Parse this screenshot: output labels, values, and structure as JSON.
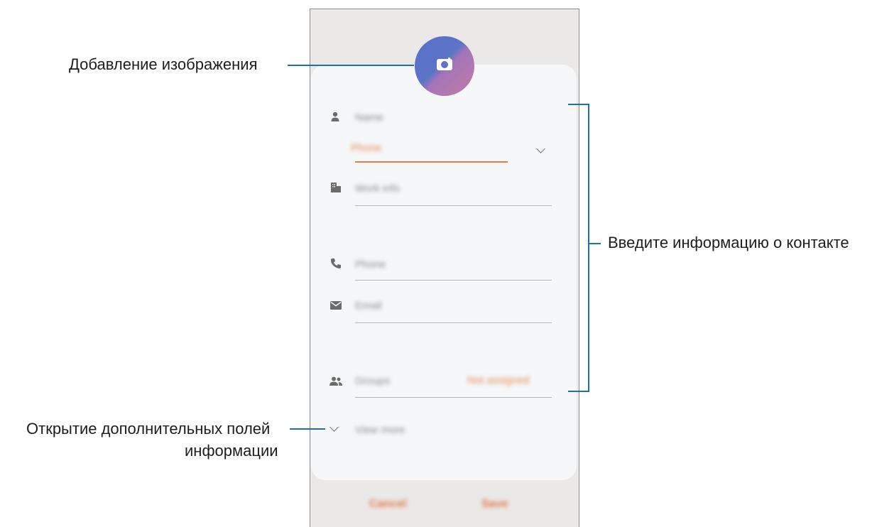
{
  "callouts": {
    "add_image": "Добавление изображения",
    "enter_info": "Введите информацию о контакте",
    "more_fields_line1": "Открытие дополнительных полей",
    "more_fields_line2": "информации"
  },
  "form": {
    "name_placeholder": "Name",
    "storage_label": "Phone",
    "organisation_placeholder": "Work info",
    "phone_placeholder": "Phone",
    "email_placeholder": "Email",
    "groups_label": "Groups",
    "groups_value": "Not assigned",
    "view_more_label": "View more"
  },
  "buttons": {
    "cancel": "Cancel",
    "save": "Save"
  },
  "icons": {
    "avatar": "camera-icon",
    "name": "person-icon",
    "organisation": "building-icon",
    "phone": "phone-icon",
    "email": "envelope-icon",
    "groups": "people-icon",
    "expand": "chevron-down-icon"
  },
  "colors": {
    "accent": "#e47b49",
    "callout_line": "#1f6fa8",
    "card_bg": "#f6f7f8",
    "screen_bg": "#ebe9e7"
  }
}
